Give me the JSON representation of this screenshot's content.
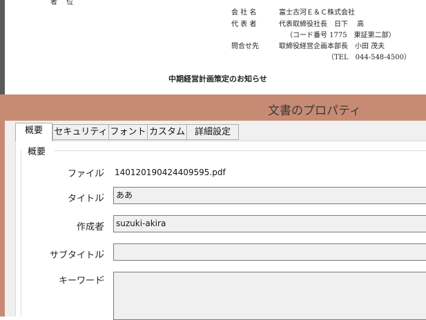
{
  "document": {
    "top_partial": "者　 位",
    "company_label": "会 社 名",
    "company_value": "富士古河Ｅ＆Ｃ株式会社",
    "rep_label": "代 表 者",
    "rep_value": "代表取締役社長　日下　 高",
    "code_line": "（コード番号 1775　東証第二部）",
    "contact_label": "問合せ先",
    "contact_value": "取締役経営企画本部長　小田 茂夫",
    "tel_line": "（TEL　044-548-4500）",
    "headline": "中期経営計画策定のお知らせ"
  },
  "dialog": {
    "title": "文書のプロパティ",
    "tabs": [
      "概要",
      "セキュリティ",
      "フォント",
      "カスタム",
      "詳細設定"
    ],
    "active_tab": 0,
    "group_title": "概要",
    "file_label": "ファイル",
    "file_value": "140120190424409595.pdf",
    "title_label": "タイトル",
    "title_value": "ああ",
    "author_label": "作成者",
    "author_value": "suzuki-akira",
    "subject_label": "サブタイトル",
    "subject_value": "",
    "keywords_label": "キーワード",
    "keywords_value": "",
    "colon": ":"
  },
  "colors": {
    "titlebar": "#c78b74",
    "dialog_bg": "#f0f0f0",
    "field_bg": "#f0f0f0"
  }
}
